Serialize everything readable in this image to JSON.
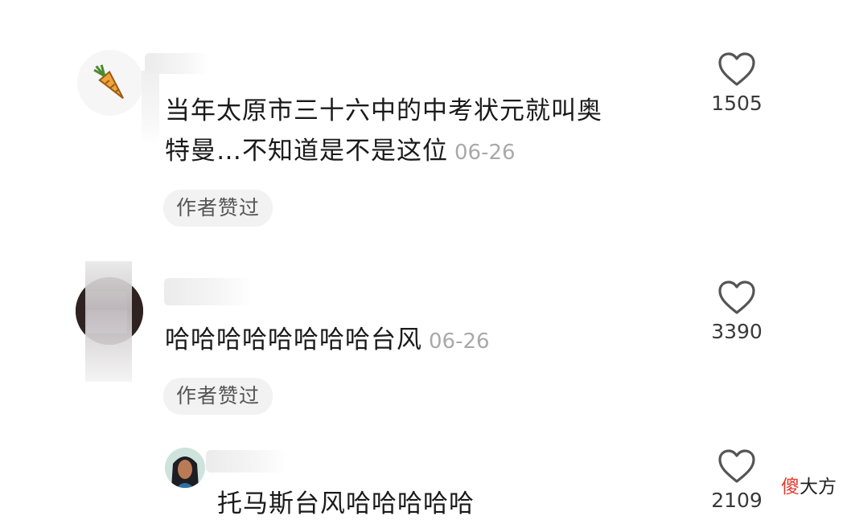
{
  "comments": [
    {
      "text_line1": "当年太原市三十六中的中考状元就叫奥",
      "text_line2": "特曼…不知道是不是这位",
      "date": "06-26",
      "badge": "作者赞过",
      "likes": "1505",
      "avatar_icon": "carrot-icon"
    },
    {
      "text": "哈哈哈哈哈哈哈哈台风",
      "date": "06-26",
      "badge": "作者赞过",
      "likes": "3390",
      "avatar_icon": "blurred-avatar"
    },
    {
      "text": "托马斯台风哈哈哈哈哈",
      "likes": "2109",
      "avatar_icon": "cartoon-girl-avatar"
    }
  ],
  "watermark": {
    "part1": "傻",
    "part2": "大方"
  },
  "colors": {
    "heart_outline": "#555555",
    "date": "#a9a9a9",
    "badge_bg": "#f2f2f2",
    "watermark_red": "#e23b2e"
  }
}
